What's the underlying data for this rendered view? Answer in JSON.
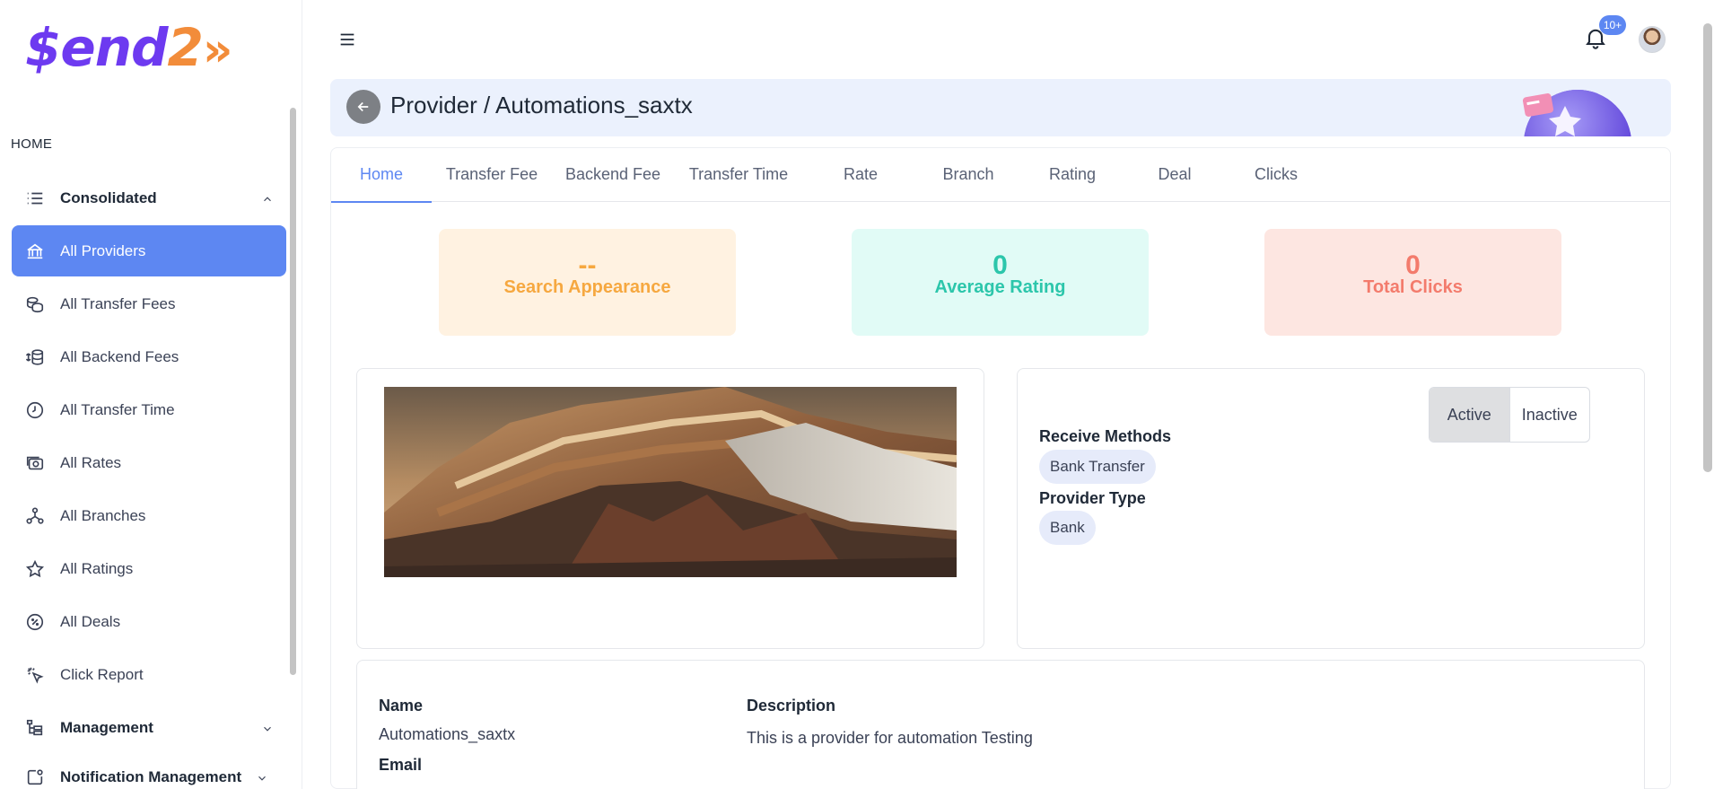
{
  "brand": {
    "logo_main": "$end",
    "logo_num": "2",
    "logo_chev": "»"
  },
  "sidebar": {
    "section_title": "HOME",
    "items": [
      {
        "label": "Consolidated",
        "icon": "list-icon",
        "group": true,
        "expanded": true
      },
      {
        "label": "All Providers",
        "icon": "bank-icon",
        "active": true
      },
      {
        "label": "All Transfer Fees",
        "icon": "coins-icon"
      },
      {
        "label": "All Backend Fees",
        "icon": "dollar-coins-icon"
      },
      {
        "label": "All Transfer Time",
        "icon": "clock-icon"
      },
      {
        "label": "All Rates",
        "icon": "camera-money-icon"
      },
      {
        "label": "All Branches",
        "icon": "branch-icon"
      },
      {
        "label": "All Ratings",
        "icon": "star-icon"
      },
      {
        "label": "All Deals",
        "icon": "percent-icon"
      },
      {
        "label": "Click Report",
        "icon": "click-icon"
      },
      {
        "label": "Management",
        "icon": "hierarchy-icon",
        "group": true,
        "expanded": false
      },
      {
        "label": "Notification Management",
        "icon": "notification-edit-icon",
        "group": true,
        "expanded": false
      }
    ]
  },
  "header": {
    "notification_count": "10+"
  },
  "breadcrumb": {
    "title": "Provider / Automations_saxtx"
  },
  "tabs": [
    {
      "label": "Home",
      "active": true
    },
    {
      "label": "Transfer Fee"
    },
    {
      "label": "Backend Fee"
    },
    {
      "label": "Transfer Time"
    },
    {
      "label": "Rate"
    },
    {
      "label": "Branch"
    },
    {
      "label": "Rating"
    },
    {
      "label": "Deal"
    },
    {
      "label": "Clicks"
    }
  ],
  "stats": [
    {
      "value": "--",
      "label": "Search Appearance"
    },
    {
      "value": "0",
      "label": "Average Rating"
    },
    {
      "value": "0",
      "label": "Total Clicks"
    }
  ],
  "status_toggle": {
    "options": [
      "Active",
      "Inactive"
    ],
    "selected": "Active"
  },
  "info": {
    "receive_methods_label": "Receive Methods",
    "receive_methods": [
      "Bank Transfer"
    ],
    "provider_type_label": "Provider Type",
    "provider_type": "Bank"
  },
  "details": {
    "name_label": "Name",
    "name_value": "Automations_saxtx",
    "description_label": "Description",
    "description_value": "This is a provider for automation Testing",
    "email_label": "Email"
  }
}
